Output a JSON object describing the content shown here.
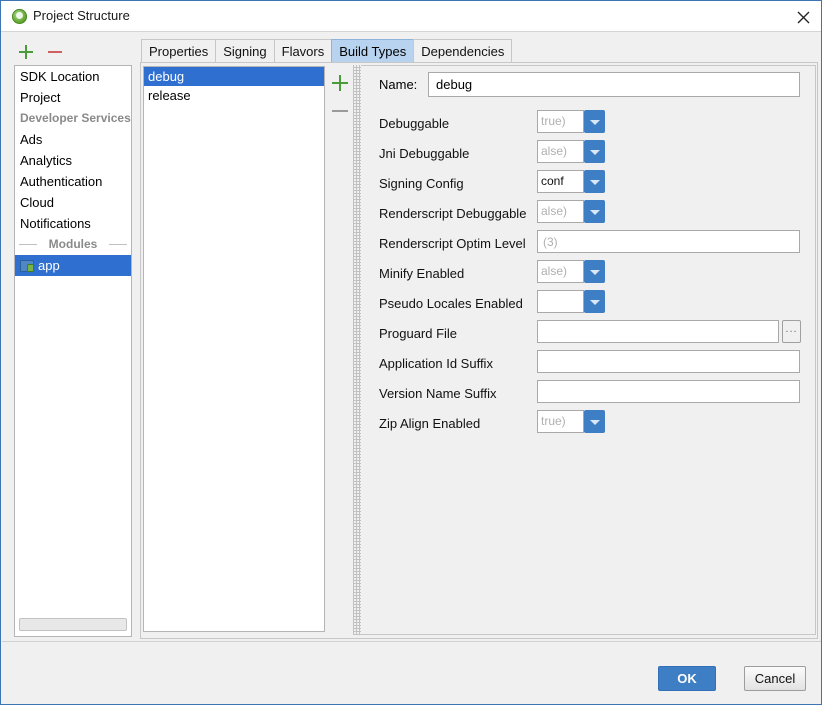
{
  "window": {
    "title": "Project Structure",
    "app_icon": "android-studio-icon",
    "close_icon": "close-icon"
  },
  "sidebar": {
    "add_label": "+",
    "remove_label": "−",
    "items": [
      {
        "label": "SDK Location",
        "type": "item",
        "selected": false
      },
      {
        "label": "Project",
        "type": "item",
        "selected": false
      },
      {
        "label": "Developer Services",
        "type": "group-plain",
        "selected": false
      },
      {
        "label": "Ads",
        "type": "item",
        "selected": false
      },
      {
        "label": "Analytics",
        "type": "item",
        "selected": false
      },
      {
        "label": "Authentication",
        "type": "item",
        "selected": false
      },
      {
        "label": "Cloud",
        "type": "item",
        "selected": false
      },
      {
        "label": "Notifications",
        "type": "item",
        "selected": false
      },
      {
        "label": "Modules",
        "type": "group-rule",
        "selected": false
      },
      {
        "label": "app",
        "type": "module",
        "selected": true
      }
    ]
  },
  "tabs": [
    {
      "label": "Properties",
      "active": false
    },
    {
      "label": "Signing",
      "active": false
    },
    {
      "label": "Flavors",
      "active": false
    },
    {
      "label": "Build Types",
      "active": true
    },
    {
      "label": "Dependencies",
      "active": false
    }
  ],
  "build_types": {
    "add_label": "+",
    "remove_label": "−",
    "items": [
      {
        "label": "debug",
        "selected": true
      },
      {
        "label": "release",
        "selected": false
      }
    ]
  },
  "form": {
    "name_label": "Name:",
    "name_value": "debug",
    "rows": [
      {
        "label": "Debuggable",
        "control": "combo",
        "value": "true)",
        "muted": true
      },
      {
        "label": "Jni Debuggable",
        "control": "combo",
        "value": "alse)",
        "muted": true
      },
      {
        "label": "Signing Config",
        "control": "combo",
        "value": "conf",
        "muted": false
      },
      {
        "label": "Renderscript Debuggable",
        "control": "combo",
        "value": "alse)",
        "muted": true
      },
      {
        "label": "Renderscript Optim Level",
        "control": "text",
        "value": "",
        "placeholder": "(3)"
      },
      {
        "label": "Minify Enabled",
        "control": "combo",
        "value": "alse)",
        "muted": true
      },
      {
        "label": "Pseudo Locales Enabled",
        "control": "combo",
        "value": "",
        "muted": true
      },
      {
        "label": "Proguard File",
        "control": "text-browse",
        "value": "",
        "placeholder": "",
        "browse_label": "..."
      },
      {
        "label": "Application Id Suffix",
        "control": "text",
        "value": "",
        "placeholder": ""
      },
      {
        "label": "Version Name Suffix",
        "control": "text",
        "value": "",
        "placeholder": ""
      },
      {
        "label": "Zip Align Enabled",
        "control": "combo",
        "value": "true)",
        "muted": true
      }
    ]
  },
  "footer": {
    "ok_label": "OK",
    "cancel_label": "Cancel"
  },
  "colors": {
    "accent_blue": "#3d7ec4",
    "selection_blue": "#2f6fd0",
    "active_tab_blue": "#b7d3f0",
    "window_bg": "#f0f0f0",
    "add_green": "#4a9c3a",
    "remove_red": "#d06060"
  }
}
